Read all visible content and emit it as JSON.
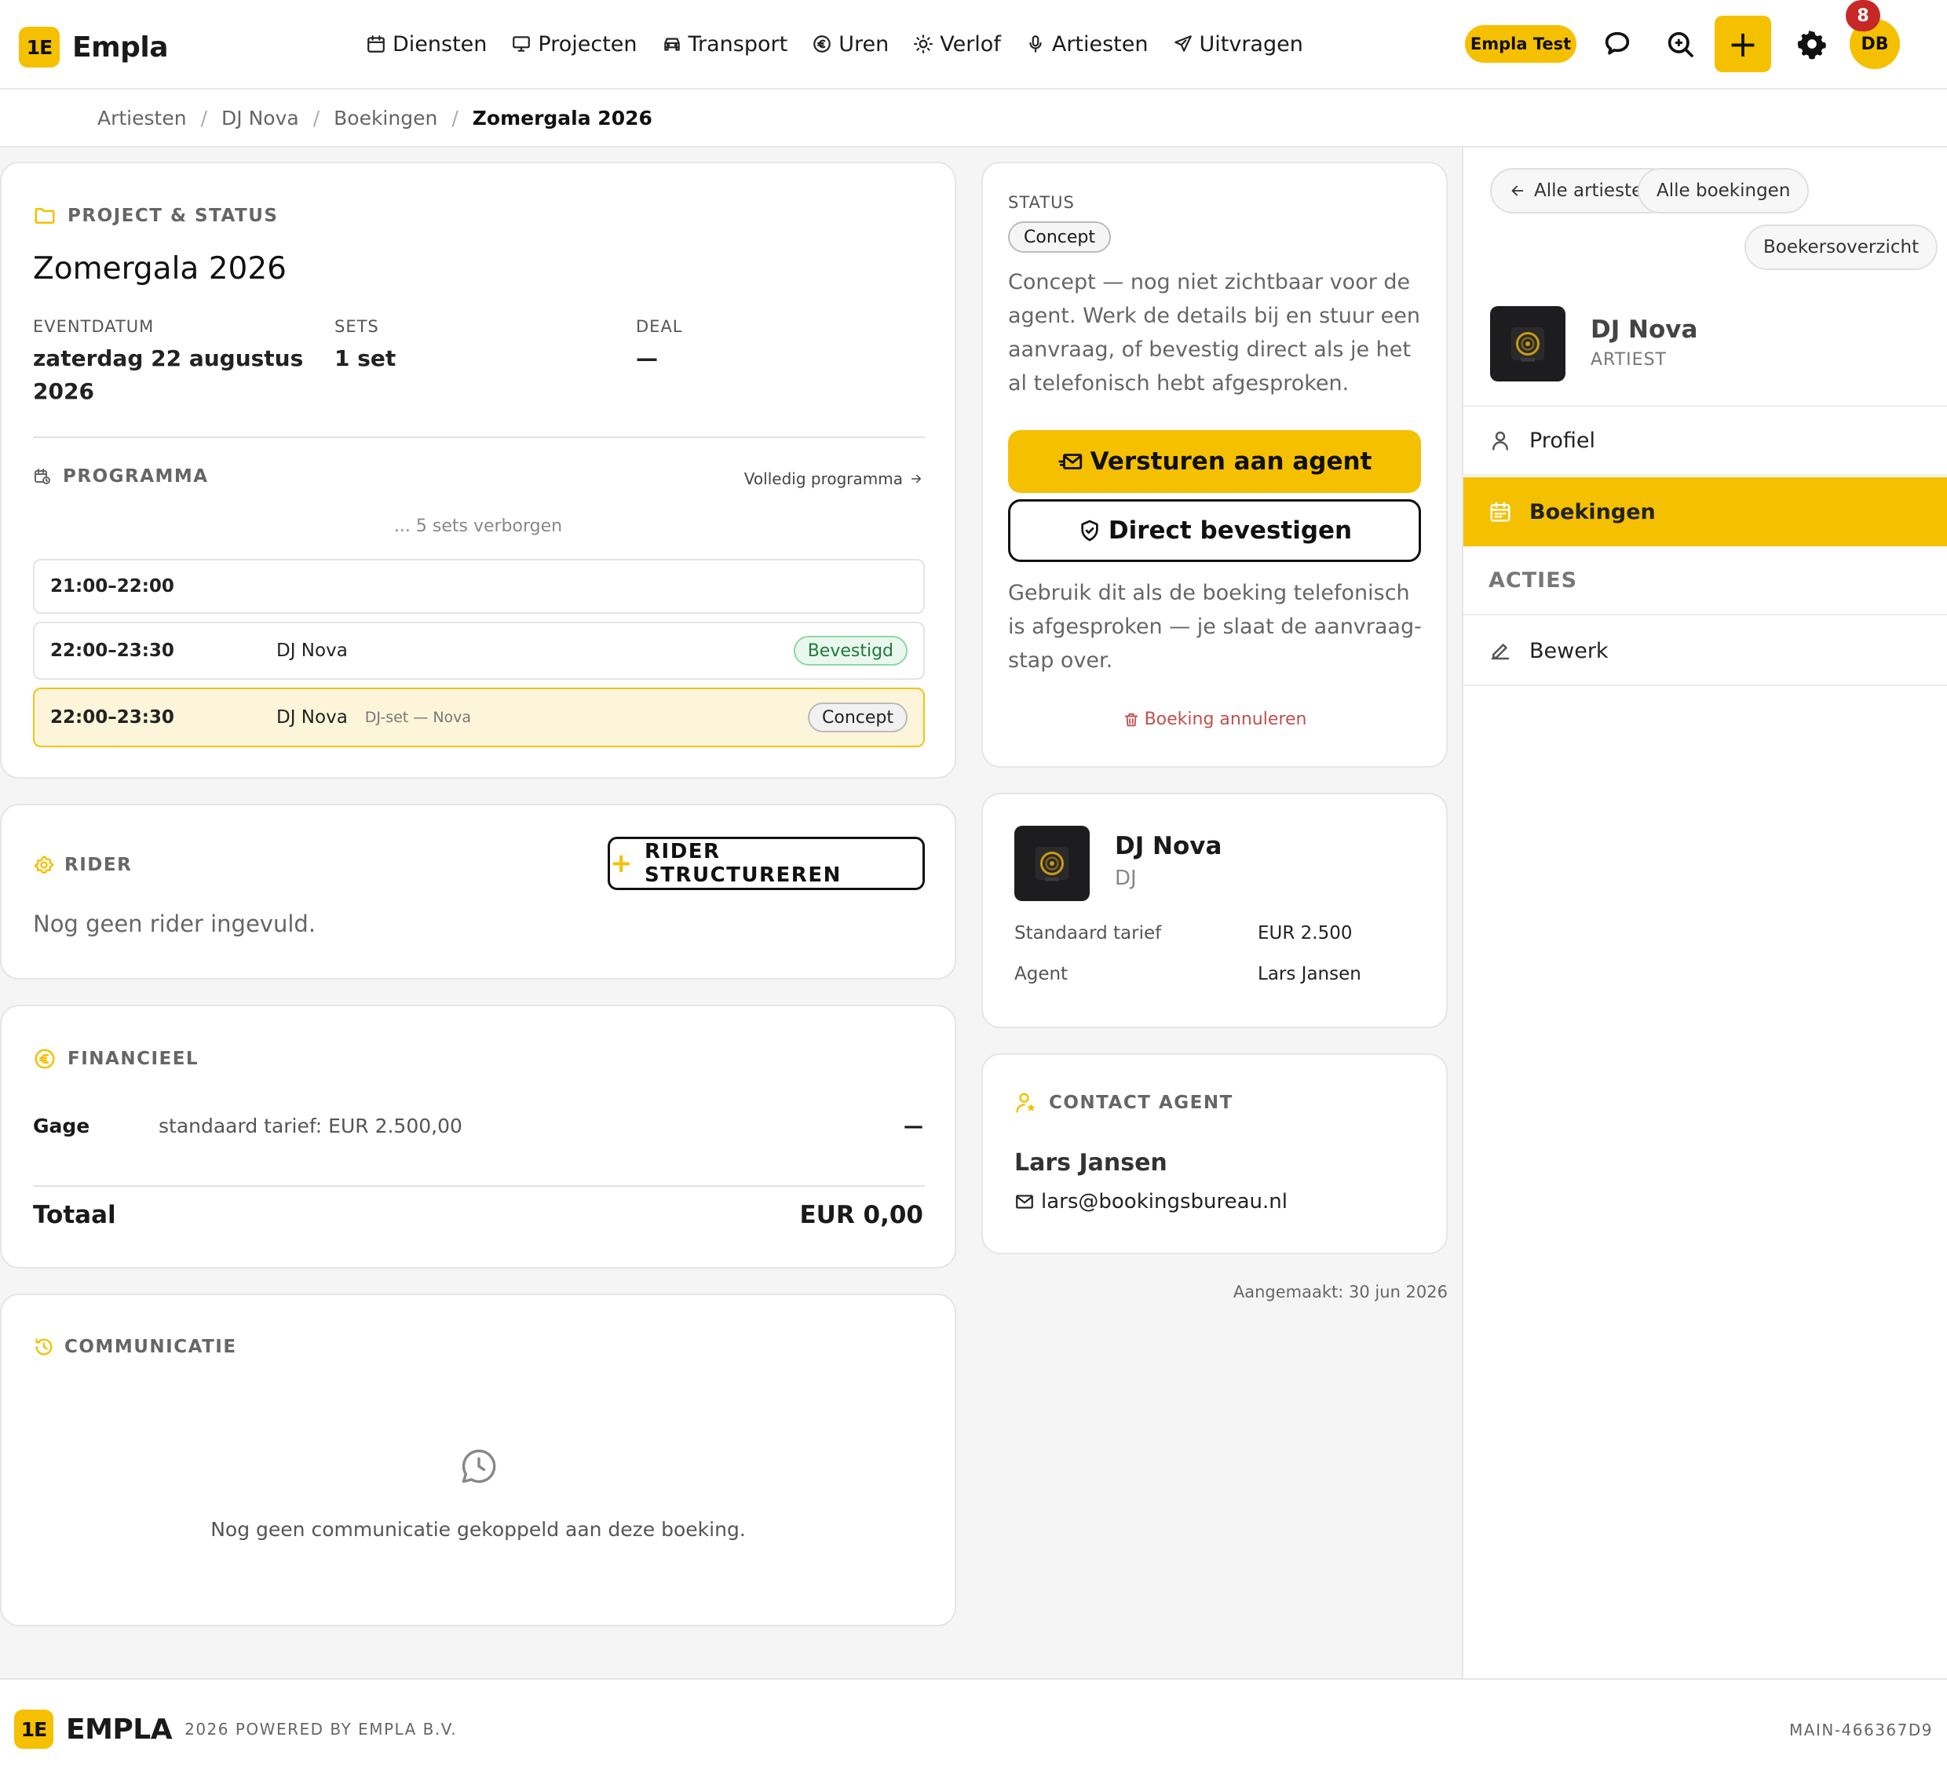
{
  "app": {
    "logo_mark": "1E",
    "name": "Empla"
  },
  "nav": {
    "items": [
      {
        "label": "Diensten",
        "icon": "calendar-icon"
      },
      {
        "label": "Projecten",
        "icon": "monitor-icon"
      },
      {
        "label": "Transport",
        "icon": "car-icon"
      },
      {
        "label": "Uren",
        "icon": "euro-icon"
      },
      {
        "label": "Verlof",
        "icon": "sun-icon"
      },
      {
        "label": "Artiesten",
        "icon": "microphone-icon"
      },
      {
        "label": "Uitvragen",
        "icon": "send-icon"
      }
    ],
    "env_badge": "Empla Test",
    "avatar_initials": "DB",
    "notification_count": "8",
    "plus_label": "+"
  },
  "breadcrumb": {
    "items": [
      "Artiesten",
      "DJ Nova",
      "Boekingen"
    ],
    "current": "Zomergala 2026"
  },
  "project": {
    "heading": "PROJECT & STATUS",
    "title": "Zomergala 2026",
    "event_date_label": "EVENTDATUM",
    "event_date_line1": "zaterdag 22 augustus",
    "event_date_line2": "2026",
    "sets_label": "SETS",
    "sets_value": "1 set",
    "deal_label": "DEAL",
    "deal_value": "—"
  },
  "program": {
    "heading": "PROGRAMMA",
    "full_link": "Volledig programma",
    "hidden_note": "... 5 sets verborgen",
    "slots": [
      {
        "time": "21:00–22:00",
        "artist": "",
        "sub": "",
        "badge": ""
      },
      {
        "time": "22:00–23:30",
        "artist": "DJ Nova",
        "sub": "",
        "badge": "Bevestigd"
      },
      {
        "time": "22:00–23:30",
        "artist": "DJ Nova",
        "sub": "DJ-set — Nova",
        "badge": "Concept"
      }
    ]
  },
  "rider": {
    "heading": "RIDER",
    "button": "RIDER STRUCTUREREN",
    "empty": "Nog geen rider ingevuld."
  },
  "financial": {
    "heading": "FINANCIEEL",
    "gage_label": "Gage",
    "gage_note": "standaard tarief: EUR 2.500,00",
    "gage_value": "—",
    "total_label": "Totaal",
    "total_value": "EUR 0,00"
  },
  "communication": {
    "heading": "COMMUNICATIE",
    "empty": "Nog geen communicatie gekoppeld aan deze boeking."
  },
  "status": {
    "label": "STATUS",
    "pill": "Concept",
    "description": "Concept — nog niet zichtbaar voor de agent. Werk de details bij en stuur een aanvraag, of bevestig direct als je het al telefonisch hebt afgesproken.",
    "send_button": "Versturen aan agent",
    "confirm_button": "Direct bevestigen",
    "confirm_note": "Gebruik dit als de boeking telefonisch is afgesproken — je slaat de aanvraag-stap over.",
    "cancel_link": "Boeking annuleren"
  },
  "artist_card": {
    "name": "DJ Nova",
    "role": "DJ",
    "rate_label": "Standaard tarief",
    "rate_value": "EUR 2.500",
    "agent_label": "Agent",
    "agent_value": "Lars Jansen"
  },
  "contact": {
    "heading": "CONTACT AGENT",
    "name": "Lars Jansen",
    "email": "lars@bookingsbureau.nl"
  },
  "created": "Aangemaakt: 30 jun 2026",
  "sidebar": {
    "chips": [
      "Alle artiesten",
      "Alle boekingen",
      "Boekersoverzicht"
    ],
    "artist_name": "DJ Nova",
    "artist_role": "ARTIEST",
    "items": [
      {
        "label": "Profiel",
        "icon": "user-icon"
      },
      {
        "label": "Boekingen",
        "icon": "calendar-icon"
      }
    ],
    "actions_heading": "ACTIES",
    "actions": [
      {
        "label": "Bewerk",
        "icon": "pencil-icon"
      }
    ]
  },
  "footer": {
    "logo_mark": "1E",
    "brand": "EMPLA",
    "powered": "2026 POWERED BY EMPLA B.V.",
    "build": "MAIN-466367D9"
  },
  "colors": {
    "accent": "#f5c000",
    "success": "#1e7a3c",
    "danger": "#c0504d",
    "notification": "#c62828"
  }
}
